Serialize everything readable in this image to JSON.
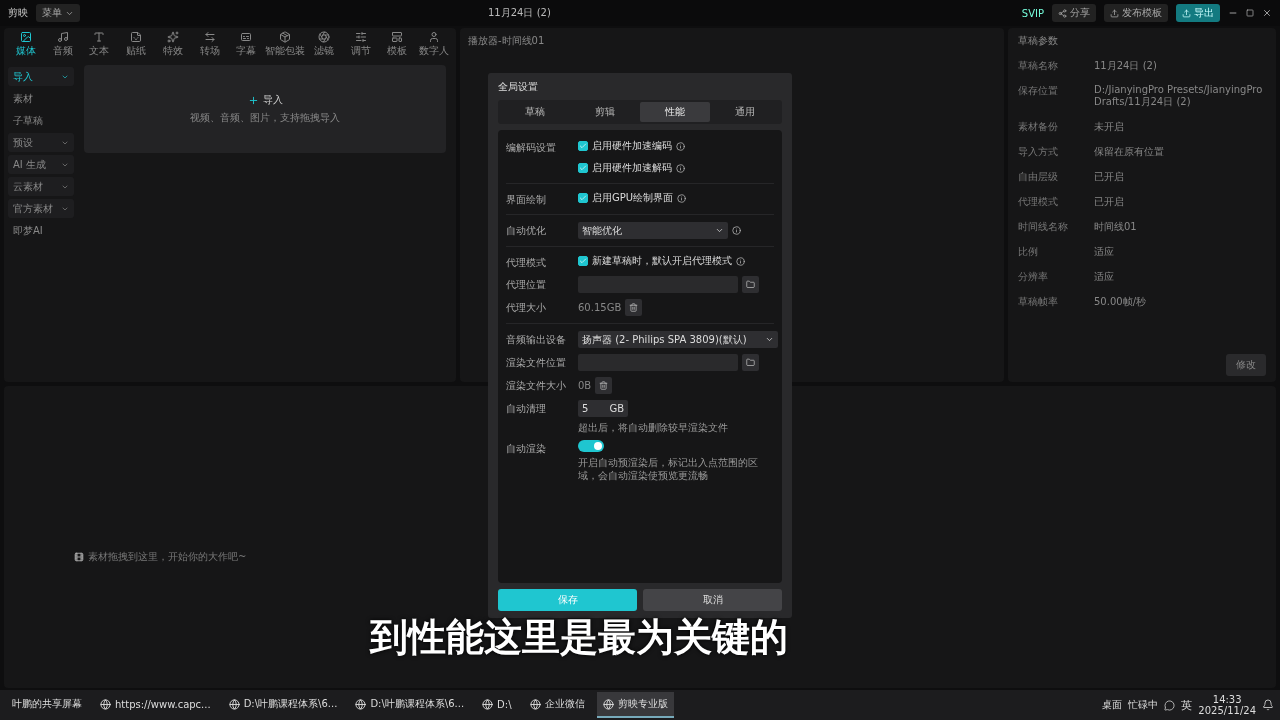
{
  "titlebar": {
    "app": "剪映",
    "menu": "菜单",
    "project": "11月24日 (2)",
    "svip": "SVIP",
    "share": "分享",
    "publish": "发布模板",
    "export": "导出"
  },
  "toolbar": [
    {
      "label": "媒体",
      "selected": true
    },
    {
      "label": "音频",
      "selected": false
    },
    {
      "label": "文本",
      "selected": false
    },
    {
      "label": "贴纸",
      "selected": false
    },
    {
      "label": "特效",
      "selected": false
    },
    {
      "label": "转场",
      "selected": false
    },
    {
      "label": "字幕",
      "selected": false
    },
    {
      "label": "智能包装",
      "selected": false
    },
    {
      "label": "滤镜",
      "selected": false
    },
    {
      "label": "调节",
      "selected": false
    },
    {
      "label": "模板",
      "selected": false
    },
    {
      "label": "数字人",
      "selected": false
    }
  ],
  "sidebar": [
    {
      "label": "导入",
      "selected": true,
      "expandable": true
    },
    {
      "label": "素材",
      "selected": false,
      "expandable": false
    },
    {
      "label": "子草稿",
      "selected": false,
      "expandable": false
    },
    {
      "label": "预设",
      "selected": false,
      "expandable": true
    },
    {
      "label": "AI 生成",
      "selected": false,
      "expandable": true
    },
    {
      "label": "云素材",
      "selected": false,
      "expandable": true
    },
    {
      "label": "官方素材",
      "selected": false,
      "expandable": true
    },
    {
      "label": "即梦AI",
      "selected": false,
      "expandable": false
    }
  ],
  "import": {
    "label": "导入",
    "hint": "视频、音频、图片，支持拖拽导入"
  },
  "player": {
    "title": "播放器-时间线01"
  },
  "draft_params": {
    "title": "草稿参数",
    "rows": [
      {
        "label": "草稿名称",
        "value": "11月24日 (2)"
      },
      {
        "label": "保存位置",
        "value": "D:/JianyingPro Presets/JianyingPro Drafts/11月24日 (2)"
      },
      {
        "label": "素材备份",
        "value": "未开启"
      },
      {
        "label": "导入方式",
        "value": "保留在原有位置"
      },
      {
        "label": "自由层级",
        "value": "已开启"
      },
      {
        "label": "代理模式",
        "value": "已开启"
      },
      {
        "label": "时间线名称",
        "value": "时间线01"
      },
      {
        "label": "比例",
        "value": "适应"
      },
      {
        "label": "分辨率",
        "value": "适应"
      },
      {
        "label": "草稿帧率",
        "value": "50.00帧/秒"
      }
    ],
    "button": "修改"
  },
  "timeline": {
    "empty_message": "素材拖拽到这里，开始你的大作吧~"
  },
  "dialog": {
    "title": "全局设置",
    "tabs": [
      {
        "label": "草稿",
        "selected": false
      },
      {
        "label": "剪辑",
        "selected": false
      },
      {
        "label": "性能",
        "selected": true
      },
      {
        "label": "通用",
        "selected": false
      }
    ],
    "sections": [
      {
        "rows": [
          {
            "label": "编解码设置",
            "kind": "check",
            "text": "启用硬件加速编码",
            "checked": true
          },
          {
            "kind": "check",
            "text": "启用硬件加速解码",
            "checked": true
          }
        ]
      },
      {
        "rows": [
          {
            "label": "界面绘制",
            "kind": "check",
            "text": "启用GPU绘制界面",
            "checked": true
          }
        ]
      },
      {
        "rows": [
          {
            "label": "自动优化",
            "kind": "select",
            "value": "智能优化"
          }
        ]
      },
      {
        "rows": [
          {
            "label": "代理模式",
            "kind": "check",
            "text": "新建草稿时，默认开启代理模式",
            "checked": true
          },
          {
            "label": "代理位置",
            "kind": "path"
          },
          {
            "label": "代理大小",
            "kind": "size",
            "value": "60.15GB"
          }
        ]
      },
      {
        "rows": [
          {
            "label": "音频输出设备",
            "kind": "select",
            "value": "扬声器 (2- Philips SPA 3809)(默认)"
          },
          {
            "label": "渲染文件位置",
            "kind": "path"
          },
          {
            "label": "渲染文件大小",
            "kind": "size",
            "value": "0B"
          },
          {
            "label": "自动清理",
            "kind": "amount",
            "value": "5",
            "unit": "GB",
            "hint": "超出后，将自动删除较早渲染文件"
          },
          {
            "label": "自动渲染",
            "kind": "toggle",
            "on": true,
            "hint": "开启自动预渲染后，标记出入点范围的区域，会自动渲染使预览更流畅"
          }
        ]
      }
    ],
    "save": "保存",
    "cancel": "取消"
  },
  "caption": "到性能这里是最为关键的",
  "taskbar": {
    "apps": [
      {
        "label": "叶鹏的共享屏幕",
        "active": false
      },
      {
        "label": "https://www.capc...",
        "active": false
      },
      {
        "label": "D:\\叶鹏课程体系\\6...",
        "active": false
      },
      {
        "label": "D:\\叶鹏课程体系\\6...",
        "active": false
      },
      {
        "label": "D:\\",
        "active": false
      },
      {
        "label": "企业微信",
        "active": false
      },
      {
        "label": "剪映专业版",
        "active": true
      }
    ],
    "desktop": "桌面",
    "status": "忙碌中",
    "ime": "英",
    "time": "14:33",
    "date": "2025/11/24"
  }
}
